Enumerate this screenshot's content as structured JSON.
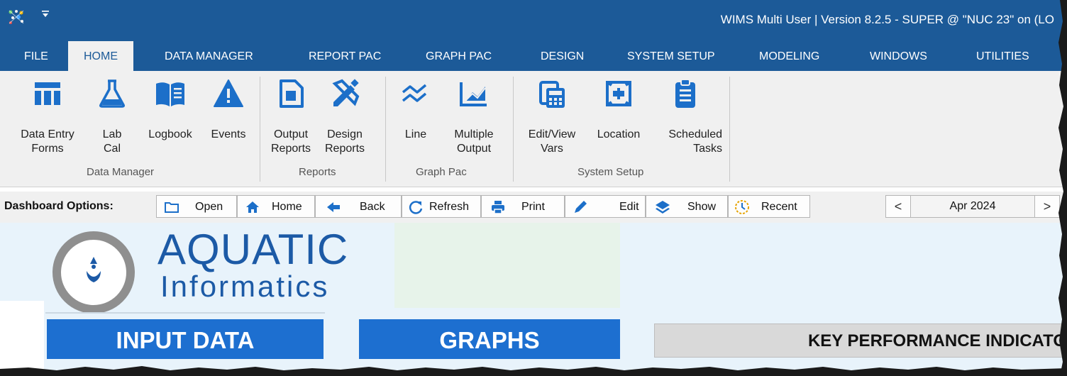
{
  "window": {
    "title": "WIMS Multi User |  Version 8.2.5 - SUPER @ \"NUC 23\" on (LO",
    "qa_toolbar_icon": "dropdown-arrow"
  },
  "tabs": [
    {
      "label": "FILE",
      "active": false
    },
    {
      "label": "HOME",
      "active": true
    },
    {
      "label": "DATA MANAGER",
      "active": false
    },
    {
      "label": "REPORT PAC",
      "active": false
    },
    {
      "label": "GRAPH PAC",
      "active": false
    },
    {
      "label": "DESIGN",
      "active": false
    },
    {
      "label": "SYSTEM SETUP",
      "active": false
    },
    {
      "label": "MODELING",
      "active": false
    },
    {
      "label": "WINDOWS",
      "active": false
    },
    {
      "label": "UTILITIES",
      "active": false
    }
  ],
  "ribbon": {
    "groups": [
      {
        "label": "Data Manager"
      },
      {
        "label": "Reports"
      },
      {
        "label": "Graph Pac"
      },
      {
        "label": "System Setup"
      }
    ],
    "buttons": [
      {
        "label": "Data Entry\nForms",
        "icon": "table-icon"
      },
      {
        "label": "Lab\nCal",
        "icon": "flask-icon"
      },
      {
        "label": "Logbook",
        "icon": "book-icon"
      },
      {
        "label": "Events",
        "icon": "warning-icon"
      },
      {
        "label": "Output\nReports",
        "icon": "report-icon"
      },
      {
        "label": "Design\nReports",
        "icon": "design-tools-icon"
      },
      {
        "label": "Line",
        "icon": "line-chart-icon"
      },
      {
        "label": "Multiple\nOutput",
        "icon": "area-chart-icon"
      },
      {
        "label": "Edit/View\nVars",
        "icon": "calculator-icon"
      },
      {
        "label": "Location",
        "icon": "location-icon"
      },
      {
        "label": "Scheduled\nTasks",
        "icon": "clipboard-icon"
      }
    ]
  },
  "dashboard_bar": {
    "label": "Dashboard Options:",
    "buttons": [
      {
        "label": "Open",
        "icon": "folder-icon"
      },
      {
        "label": "Home",
        "icon": "home-icon"
      },
      {
        "label": "Back",
        "icon": "back-arrow-icon"
      },
      {
        "label": "Refresh",
        "icon": "refresh-icon"
      },
      {
        "label": "Print",
        "icon": "printer-icon"
      },
      {
        "label": "Edit",
        "icon": "pencil-icon"
      },
      {
        "label": "Show",
        "icon": "layers-icon"
      },
      {
        "label": "Recent",
        "icon": "clock-icon"
      }
    ],
    "prev": "<",
    "next": ">",
    "month": "Apr 2024"
  },
  "dashboard": {
    "logo_main": "AQUATIC",
    "logo_sub": "Informatics",
    "input_data": "INPUT DATA",
    "graphs": "GRAPHS",
    "kpi": "KEY PERFORMANCE INDICATO"
  },
  "colors": {
    "titlebar": "#1c5a98",
    "ribbon_icon": "#1c6fc9",
    "section_button": "#1d6fd0",
    "content_bg": "#e8f3fb"
  }
}
